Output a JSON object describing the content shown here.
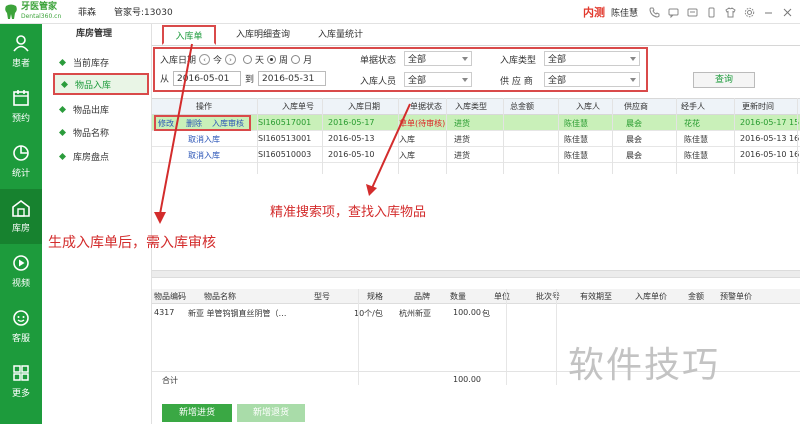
{
  "topbar": {
    "logo_cn": "牙医管家",
    "logo_en": "Dental360.cn",
    "user": "菲森",
    "account": "管家号:13030",
    "env": "内测",
    "name": "陈佳慧"
  },
  "leftnav": [
    {
      "label": "患者",
      "icon": "person-icon"
    },
    {
      "label": "预约",
      "icon": "calendar-icon"
    },
    {
      "label": "统计",
      "icon": "pie-chart-icon"
    },
    {
      "label": "库房",
      "icon": "warehouse-icon"
    },
    {
      "label": "视频",
      "icon": "video-icon"
    },
    {
      "label": "客服",
      "icon": "support-icon"
    },
    {
      "label": "更多",
      "icon": "grid-icon"
    }
  ],
  "submenu": {
    "title": "库房管理",
    "items": [
      "当前库存",
      "物品入库",
      "物品出库",
      "物品名称",
      "库房盘点"
    ]
  },
  "tabs": [
    "入库单",
    "入库明细查询",
    "入库量统计"
  ],
  "filter": {
    "date_label": "入库日期",
    "today": "今",
    "day": "天",
    "week": "周",
    "month": "月",
    "from_label": "从",
    "from": "2016-05-01",
    "to_label": "到",
    "to": "2016-05-31",
    "status_label": "单据状态",
    "status_value": "全部",
    "person_label": "入库人员",
    "person_value": "全部",
    "type_label": "入库类型",
    "type_value": "全部",
    "supplier_label": "供 应 商",
    "supplier_value": "全部",
    "query": "查询"
  },
  "table": {
    "headers": [
      "操作",
      "入库单号",
      "入库日期",
      "单据状态",
      "入库类型",
      "总金额",
      "入库人",
      "供应商",
      "经手人",
      "更新时间"
    ],
    "rows": [
      {
        "ops": [
          "修改",
          "删除",
          "入库审核"
        ],
        "no": "SI160517001",
        "date": "2016-05-17",
        "status": "草单(待审核)",
        "type": "进货",
        "amount": "",
        "person": "陈佳慧",
        "supplier": "晨会",
        "handler": "花花",
        "updated": "2016-05-17 15:"
      },
      {
        "ops": [
          "取消入库"
        ],
        "no": "SI160513001",
        "date": "2016-05-13",
        "status": "入库",
        "type": "进货",
        "amount": "",
        "person": "陈佳慧",
        "supplier": "晨会",
        "handler": "陈佳慧",
        "updated": "2016-05-13 16:"
      },
      {
        "ops": [
          "取消入库"
        ],
        "no": "SI160510003",
        "date": "2016-05-10",
        "status": "入库",
        "type": "进货",
        "amount": "",
        "person": "陈佳慧",
        "supplier": "晨会",
        "handler": "陈佳慧",
        "updated": "2016-05-10 16:"
      }
    ]
  },
  "annotations": {
    "search": "精准搜索项，查找入库物品",
    "audit": "生成入库单后，需入库审核"
  },
  "detail": {
    "headers": [
      "物品编码",
      "物品名称",
      "型号",
      "规格",
      "品牌",
      "数量",
      "单位",
      "批次号",
      "有效期至",
      "入库单价",
      "金额",
      "预警单价"
    ],
    "rows": [
      {
        "code": "4317",
        "name": "新亚 单管钨钢直丝阴管（…",
        "model": "",
        "spec": "10个/包",
        "brand": "杭州新亚",
        "qty": "100.00",
        "unit": "包"
      }
    ],
    "total_label": "合计",
    "total_qty": "100.00"
  },
  "buttons": {
    "new_stock": "新增进货",
    "new_return": "新增退货"
  },
  "watermark": "软件技巧"
}
